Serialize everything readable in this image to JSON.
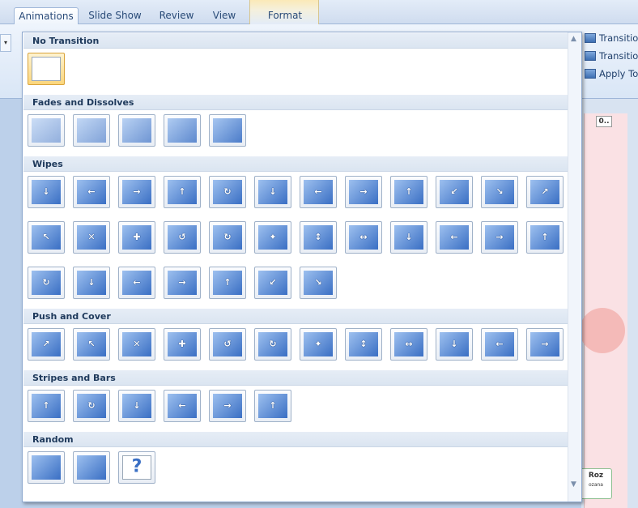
{
  "ribbon": {
    "tabs": [
      "Animations",
      "Slide Show",
      "Review",
      "View"
    ],
    "contextual_tab": "Format",
    "commands": [
      "Transition",
      "Transition",
      "Apply To"
    ],
    "dropdown_glyph": "▾"
  },
  "gallery": {
    "sections": [
      {
        "title": "No Transition",
        "count": 1
      },
      {
        "title": "Fades and Dissolves",
        "count": 5
      },
      {
        "title": "Wipes",
        "count": 31
      },
      {
        "title": "Push and Cover",
        "count": 12
      },
      {
        "title": "Stripes and Bars",
        "count": 6
      },
      {
        "title": "Random",
        "count": 3
      }
    ],
    "selected": "No Transition",
    "scroll_up": "▲",
    "scroll_down": "▼"
  },
  "slide": {
    "tag": "0..",
    "logo_title": "Roz",
    "logo_sub": "ozana"
  },
  "colors": {
    "accent": "#3a6fc4",
    "selected_fill": "#fbd67c",
    "section_header": "#dbe5f1"
  }
}
